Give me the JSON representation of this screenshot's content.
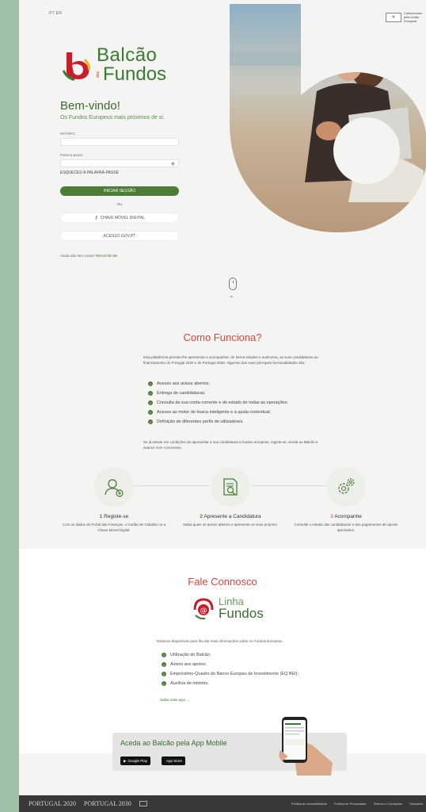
{
  "header": {
    "language": "PT EN",
    "eu_badge_icon": "eu-flag",
    "eu_badge_text": "Cofinanciado pela União Europeia"
  },
  "logo": {
    "word1": "Balcão",
    "word_small": "dos",
    "word2": "Fundos"
  },
  "login": {
    "welcome": "Bem-vindo!",
    "subtitle": "Os Fundos Europeus mais próximos de si.",
    "nif_label": "NIF/NIPC",
    "password_label": "Palavra-passe",
    "forgot": "ESQUECEU A PALAVRA-PASSE",
    "signin": "INICIAR SESSÃO",
    "or": "OU",
    "chave_movel": "CHAVE MÓVEL DIGITAL",
    "acesso_gov": "ACESSO.GOV.PT",
    "no_account": "Ainda não tem conta?",
    "register_link": "REGISTE-SE"
  },
  "como": {
    "title": "Como Funciona?",
    "intro": "Esta plataforma permite-lhe apresentar e acompanhar, de forma simples e autónoma, as suas candidaturas ao financiamento do Portugal 2020 e do Portugal 2030. Algumas das suas principais funcionalidades são:",
    "items": [
      "Acesso aos avisos abertos;",
      "Entrega de candidaturas;",
      "Consulta da sua conta-corrente e do estado de todas as operações;",
      "Acesso ao motor de busca inteligente e à ajuda contextual;",
      "Definição de diferentes perfis de utilizadores."
    ],
    "outro": "Se já estiver em condições de apresentar a sua candidatura a fundos europeus, registe-se, aceda ao Balcão e avance com o processo.",
    "steps": [
      {
        "num": "1",
        "title": "Registe-se",
        "desc": "Com os dados do Portal das Finanças, o Cartão de Cidadão ou a Chave Móvel Digital.",
        "icon": "user-add-icon"
      },
      {
        "num": "2",
        "title": "Apresente a Candidatura",
        "desc": "Saiba quais os avisos abertos e apresente os seus projetos.",
        "icon": "document-search-icon"
      },
      {
        "num": "3",
        "title": "Acompanhe",
        "desc": "Consulte o estado das candidaturas e dos pagamentos de apoios aprovados.",
        "icon": "gears-icon"
      }
    ]
  },
  "contact": {
    "title": "Fale Connosco",
    "linha_w1": "Linha",
    "linha_w2": "Fundos",
    "intro": "Estamos disponíveis para lhe dar mais informações sobre os Fundos Europeus.",
    "items": [
      "Utilização do Balcão;",
      "Avisos aos apoios;",
      "Empréstimo-Quadro do Banco Europeu de Investimento (EQ BEI);",
      "Auxílios de minimis."
    ],
    "see_more": "Saiba mais aqui →"
  },
  "app": {
    "title": "Aceda ao Balcão pela App Mobile",
    "google_play": "Google Play",
    "app_store": "App Store"
  },
  "footer": {
    "logo1": "PORTUGAL 2020",
    "logo2": "PORTUGAL 2030",
    "links": [
      "Política de Acessibilidade",
      "Política de Privacidade",
      "Termos e Condições",
      "Glossário"
    ]
  },
  "colors": {
    "brand_green": "#4d7c36",
    "brand_red": "#d9443c",
    "side_bg": "#9fbfa7"
  }
}
